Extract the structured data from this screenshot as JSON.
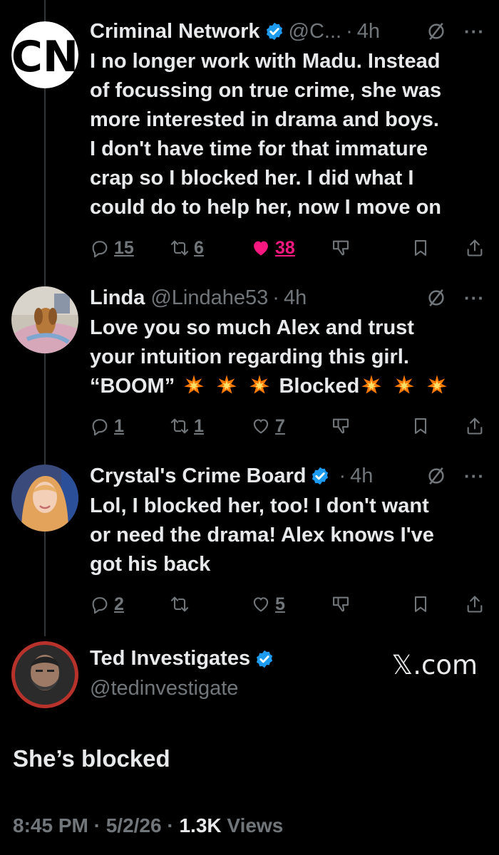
{
  "tweets": [
    {
      "name": "Criminal Network",
      "handle": "@C...",
      "time": "4h",
      "lines": [
        "I no longer work with Madu. Instead",
        "of focussing on true crime, she was",
        "more interested in drama and boys.",
        "I don't have time for that immature",
        "crap so I blocked her. I did what I",
        "could do to help her, now I move on"
      ],
      "replies": "15",
      "reposts": "6",
      "likes": "38",
      "avatar_text": "CN"
    },
    {
      "name": "Linda",
      "handle": "@Lindahe53",
      "time": "4h",
      "lines": [
        "Love you so much Alex and trust",
        "your intuition regarding this girl."
      ],
      "line3_start": "“BOOM”",
      "line3_mid": "Blocked",
      "replies": "1",
      "reposts": "1",
      "likes": "7"
    },
    {
      "name": "Crystal's Crime Board",
      "time": "4h",
      "lines": [
        "Lol, I blocked her, too! I don't want",
        "or need the drama! Alex knows I've",
        "got his back"
      ],
      "replies": "2",
      "likes": "5"
    }
  ],
  "main": {
    "name": "Ted Investigates",
    "handle": "@tedinvestigate",
    "brand": "𝕏.com",
    "text": "She’s blocked",
    "time": "8:45 PM",
    "date": "5/2/26",
    "views_count": "1.3K",
    "views_label": "Views"
  },
  "more_glyph": "···",
  "colors": {
    "background": "#000000",
    "text": "#e7e9ea",
    "muted": "#71767b",
    "verified": "#1d9bf0",
    "like": "#f91880"
  },
  "icons": [
    "reply-icon",
    "repost-icon",
    "like-icon",
    "grok-icon",
    "bookmark-icon",
    "share-icon",
    "verified-icon",
    "more-icon",
    "explosion-emoji"
  ]
}
